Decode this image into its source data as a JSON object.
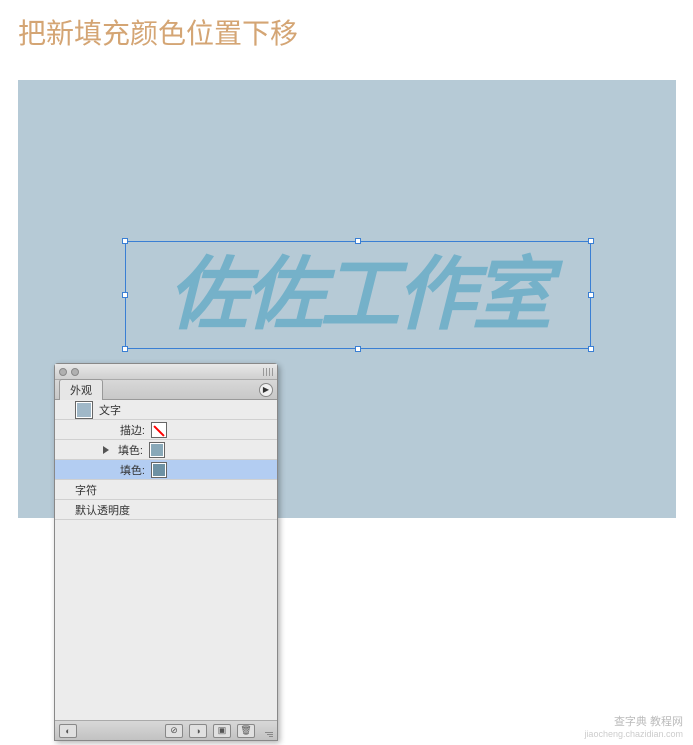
{
  "title": "把新填充颜色位置下移",
  "canvas": {
    "bg_color": "#b6cad6",
    "text_content": "佐佐工作室",
    "text_fill": "#75b1c9"
  },
  "appearance_panel": {
    "tab_label": "外观",
    "object_row": {
      "label": "文字",
      "swatch_color": "#a0b8c8"
    },
    "rows": [
      {
        "label": "描边:",
        "swatch": "none",
        "has_triangle": false,
        "selected": false
      },
      {
        "label": "填色:",
        "swatch": "#88a8b8",
        "has_triangle": true,
        "selected": false
      },
      {
        "label": "填色:",
        "swatch": "#6d91a4",
        "has_triangle": false,
        "selected": true
      },
      {
        "label": "字符",
        "swatch": null,
        "has_triangle": false,
        "selected": false,
        "full_left": true
      },
      {
        "label": "默认透明度",
        "swatch": null,
        "has_triangle": false,
        "selected": false,
        "full_left": true
      }
    ],
    "footer_icons": {
      "fx": "fx",
      "none": "none",
      "dup": "dup",
      "new": "new",
      "trash": "trash"
    }
  },
  "watermark": {
    "line1": "查字典 教程网",
    "line2": "jiaocheng.chazidian.com"
  }
}
